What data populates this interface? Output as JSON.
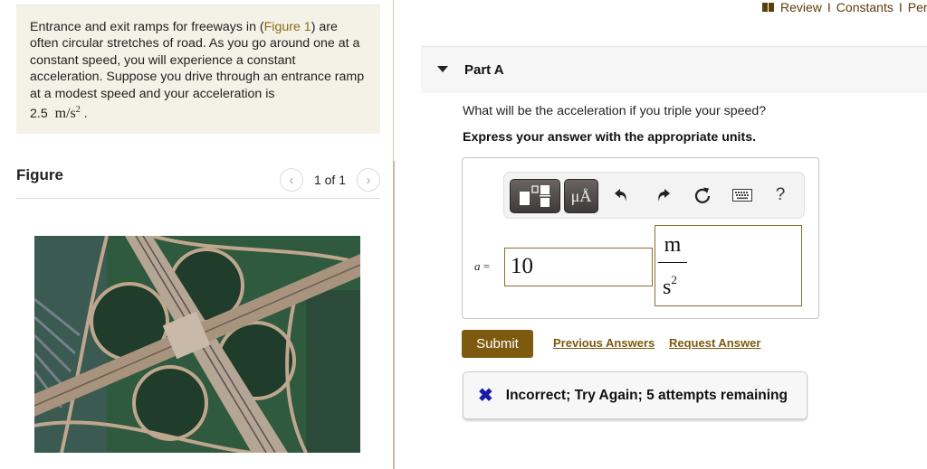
{
  "header_links": {
    "items": [
      "Review",
      "Constants",
      "Per"
    ],
    "separator": "I"
  },
  "problem": {
    "text_before_link": "Entrance and exit ramps for freeways in (",
    "figure_link": "Figure 1",
    "text_after_link": ") are often circular stretches of road. As you go around one at a constant speed, you will experience a constant acceleration. Suppose you drive through an entrance ramp at a modest speed and your acceleration is",
    "value": "2.5",
    "unit_base": "m/s",
    "unit_exp": "2",
    "trailing": "."
  },
  "figure": {
    "title": "Figure",
    "counter": "1 of 1",
    "prev_icon": "chevron-left-icon",
    "next_icon": "chevron-right-icon",
    "image_description": "Aerial view of a cloverleaf freeway interchange"
  },
  "part": {
    "title": "Part A",
    "question": "What will be the acceleration if you triple your speed?",
    "instruction": "Express your answer with the appropriate units."
  },
  "toolbar": {
    "templates_icon": "templates-icon",
    "units_label": "μÅ",
    "undo_icon": "undo-icon",
    "redo_icon": "redo-icon",
    "reset_icon": "reset-icon",
    "keyboard_icon": "keyboard-icon",
    "help_label": "?"
  },
  "answer": {
    "variable": "a",
    "equals": "=",
    "value": "10",
    "unit_numerator": "m",
    "unit_denominator": "s",
    "unit_denominator_exp": "2"
  },
  "actions": {
    "submit": "Submit",
    "previous_answers": "Previous Answers",
    "request_answer": "Request Answer"
  },
  "feedback": {
    "icon": "✖",
    "message": "Incorrect; Try Again; 5 attempts remaining"
  },
  "colors": {
    "accent": "#7e5a0f",
    "intro_bg": "#f4f2e6",
    "feedback_x": "#1a1aa8",
    "input_border": "#8a6d2c"
  }
}
